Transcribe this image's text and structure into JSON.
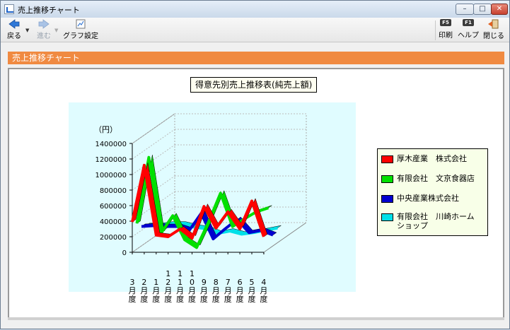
{
  "window": {
    "title": "売上推移チャート",
    "min": "–",
    "max": "□",
    "close": "✕"
  },
  "toolbar": {
    "back_label": "戻る",
    "forward_label": "進む",
    "graph_settings_label": "グラフ設定",
    "print_label": "印刷",
    "print_key": "F5",
    "help_label": "ヘルプ",
    "help_key": "F1",
    "close_label": "閉じる"
  },
  "section_title": "売上推移チャート",
  "chart_data": {
    "type": "line",
    "title": "得意先別売上推移表(純売上額)",
    "ylabel": "（円）",
    "ylim": [
      0,
      1400000
    ],
    "yticks": [
      "1400000",
      "1200000",
      "1000000",
      "800000",
      "600000",
      "400000",
      "200000",
      "0"
    ],
    "categories": [
      "3月度",
      "2月度",
      "1月度",
      "12月度",
      "11月度",
      "10月度",
      "9月度",
      "8月度",
      "7月度",
      "6月度",
      "5月度",
      "4月度"
    ],
    "series": [
      {
        "name": "厚木産業　株式会社",
        "color": "#ff0000",
        "values": [
          390000,
          1120000,
          220000,
          200000,
          300000,
          180000,
          590000,
          310000,
          520000,
          300000,
          660000,
          200000
        ]
      },
      {
        "name": "有限会社　文京食器店",
        "color": "#00e000",
        "values": [
          330000,
          1180000,
          200000,
          430000,
          120000,
          20000,
          350000,
          720000,
          290000,
          390000,
          480000,
          530000
        ]
      },
      {
        "name": "中央産業株式会社",
        "color": "#0000d0",
        "values": [
          250000,
          260000,
          250000,
          250000,
          200000,
          420000,
          90000,
          220000,
          340000,
          170000,
          200000,
          140000
        ]
      },
      {
        "name": "有限会社　川崎ホーム\nショップ",
        "color": "#00e0e8",
        "values": [
          220000,
          220000,
          240000,
          240000,
          200000,
          180000,
          120000,
          150000,
          110000,
          130000,
          160000,
          190000
        ]
      }
    ]
  }
}
